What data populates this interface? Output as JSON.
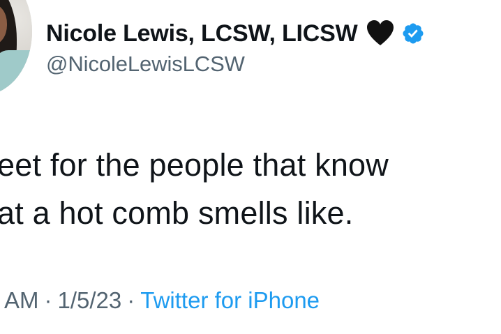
{
  "author": {
    "display_name": "Nicole Lewis, LCSW, LICSW",
    "handle": "@NicoleLewisLCSW",
    "name_emoji": "black-heart",
    "verified": true
  },
  "tweet": {
    "lines": [
      "eet for the people that know",
      "at a hot comb smells like."
    ]
  },
  "meta": {
    "time": "AM",
    "separator": "·",
    "date": "1/5/23",
    "source": "Twitter for iPhone"
  },
  "colors": {
    "text_primary": "#0f1419",
    "text_secondary": "#536471",
    "link": "#1d9bf0",
    "verified_badge": "#1d9bf0"
  }
}
